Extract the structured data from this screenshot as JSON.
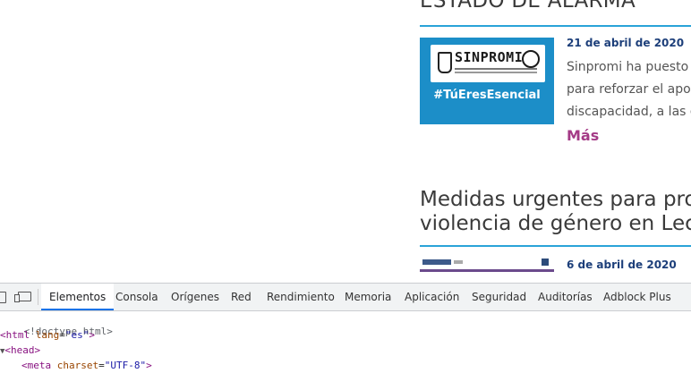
{
  "page": {
    "section1_heading": "ESTADO DE ALARMA",
    "article1": {
      "date": "21 de abril de 2020",
      "lines": [
        "Sinpromi  ha puesto e",
        "para reforzar el apoyo",
        "discapacidad, a las qu"
      ],
      "more_label": "Más",
      "thumb": {
        "brand": "SINPROMI",
        "hashtag": "#TúEresEsencial"
      }
    },
    "section2_heading_lines": [
      "Medidas urgentes para prote",
      "violencia de género en Lectu"
    ],
    "article2": {
      "date": "6 de abril de 2020"
    }
  },
  "devtools": {
    "tabs": [
      {
        "label": "Elementos",
        "active": true
      },
      {
        "label": "Consola"
      },
      {
        "label": "Orígenes"
      },
      {
        "label": "Red"
      },
      {
        "label": "Rendimiento"
      },
      {
        "label": "Memoria"
      },
      {
        "label": "Aplicación"
      },
      {
        "label": "Seguridad"
      },
      {
        "label": "Auditorías"
      },
      {
        "label": "Adblock Plus"
      }
    ],
    "code": {
      "doctype": "<!doctype html>",
      "html_open_tag": "<html",
      "html_attr": "lang",
      "html_attr_val": "\"es\"",
      "head_tag": "<head>",
      "meta_tag": "<meta",
      "meta_attr": "charset",
      "meta_attr_val": "\"UTF-8\""
    }
  },
  "colors": {
    "accent_blue": "#2aa3d8",
    "date_blue": "#1d3f7a",
    "more_purple": "#a43a86",
    "devtools_active_tab": "#1a73e8"
  }
}
